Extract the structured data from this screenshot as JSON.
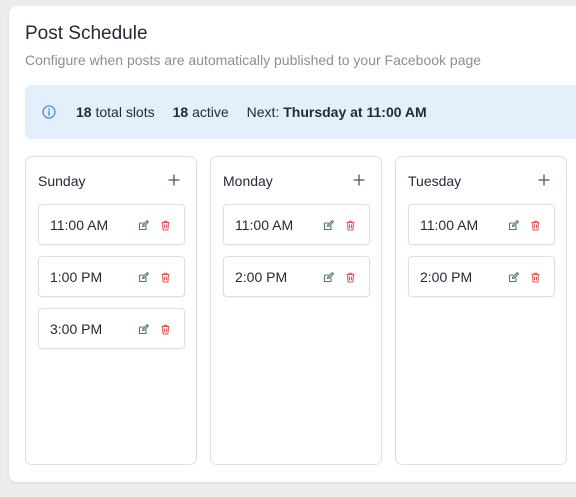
{
  "header": {
    "title": "Post Schedule",
    "subtitle": "Configure when posts are automatically published to your Facebook page"
  },
  "summary": {
    "total_count": "18",
    "total_label": "total slots",
    "active_count": "18",
    "active_label": "active",
    "next_label": "Next:",
    "next_value": "Thursday at 11:00 AM",
    "icon": "info-icon"
  },
  "colors": {
    "accent_blue": "#4a90d9",
    "edit_green": "#4c7a6e",
    "delete_red": "#e05a5a"
  },
  "days": [
    {
      "name": "Sunday",
      "slots": [
        {
          "time": "11:00 AM"
        },
        {
          "time": "1:00 PM"
        },
        {
          "time": "3:00 PM"
        }
      ]
    },
    {
      "name": "Monday",
      "slots": [
        {
          "time": "11:00 AM"
        },
        {
          "time": "2:00 PM"
        }
      ]
    },
    {
      "name": "Tuesday",
      "slots": [
        {
          "time": "11:00 AM"
        },
        {
          "time": "2:00 PM"
        }
      ]
    }
  ]
}
